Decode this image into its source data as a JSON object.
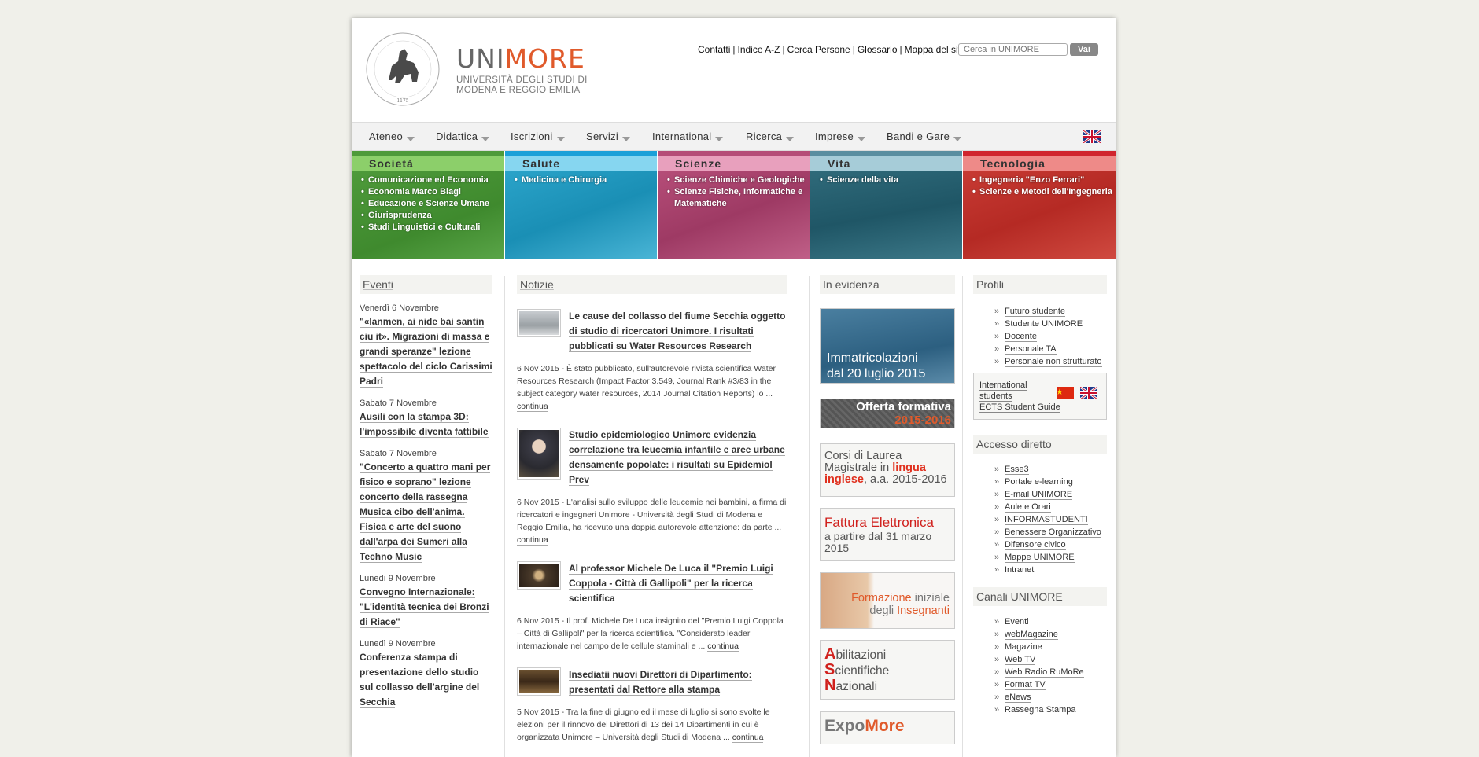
{
  "header": {
    "logo_word_1": "UNI",
    "logo_word_2": "MORE",
    "logo_sub_1": "UNIVERSITÀ DEGLI STUDI DI",
    "logo_sub_2": "MODENA E REGGIO EMILIA",
    "seal_text": "UNIVERSITAS STUDIORUM MUTINENSIS ET REGIENSIS",
    "seal_year": "1175",
    "links": [
      "Contatti",
      "Indice A-Z",
      "Cerca Persone",
      "Glossario",
      "Mappa del sito"
    ],
    "search_placeholder": "Cerca in UNIMORE",
    "search_button": "Vai"
  },
  "menu": [
    "Ateneo",
    "Didattica",
    "Iscrizioni",
    "Servizi",
    "International",
    "Ricerca",
    "Imprese",
    "Bandi e Gare"
  ],
  "areas": [
    {
      "title": "Società",
      "color": "#4e9a3a",
      "items": [
        "Comunicazione ed Economia",
        "Economia Marco Biagi",
        "Educazione e Scienze Umane",
        "Giurisprudenza",
        "Studi Linguistici e Culturali"
      ]
    },
    {
      "title": "Salute",
      "color": "#2aa3c9",
      "items": [
        "Medicina e Chirurgia"
      ]
    },
    {
      "title": "Scienze",
      "color": "#b54d78",
      "items": [
        "Scienze Chimiche e Geologiche",
        "Scienze Fisiche, Informatiche e Matematiche"
      ]
    },
    {
      "title": "Vita",
      "color": "#2f6a7a",
      "items": [
        "Scienze della vita"
      ]
    },
    {
      "title": "Tecnologia",
      "color": "#c73a33",
      "items": [
        "Ingegneria \"Enzo Ferrari\"",
        "Scienze e Metodi dell'Ingegneria"
      ]
    }
  ],
  "events": {
    "title": "Eventi",
    "items": [
      {
        "date": "Venerdì 6 Novembre",
        "title": "\"«Ianmen, ai nide bai santin ciu it». Migrazioni di massa e grandi speranze\" lezione spettacolo del ciclo Carissimi Padri"
      },
      {
        "date": "Sabato 7 Novembre",
        "title": "Ausili con la stampa 3D: l'impossibile diventa fattibile"
      },
      {
        "date": "Sabato 7 Novembre",
        "title": "\"Concerto a quattro mani per fisico e soprano\" lezione concerto della rassegna Musica cibo dell'anima. Fisica e arte del suono dall'arpa dei Sumeri alla Techno Music"
      },
      {
        "date": "Lunedì 9 Novembre",
        "title": "Convegno Internazionale: \"L'identità tecnica dei Bronzi di Riace\""
      },
      {
        "date": "Lunedì 9 Novembre",
        "title": "Conferenza stampa di presentazione dello studio sul collasso dell'argine del Secchia"
      }
    ]
  },
  "news": {
    "title": "Notizie",
    "more_label": "continua",
    "items": [
      {
        "title": "Le cause del collasso del fiume Secchia oggetto di studio di ricercatori Unimore. I risultati pubblicati su Water Resources Research",
        "text": "6 Nov 2015 - È stato pubblicato, sull'autorevole rivista scientifica Water Resources Research (Impact Factor 3.549, Journal Rank #3/83 in the subject category water resources, 2014 Journal Citation Reports) lo ..."
      },
      {
        "title": "Studio epidemiologico Unimore evidenzia correlazione tra leucemia infantile e aree urbane densamente popolate: i risultati su Epidemiol Prev",
        "text": "6 Nov 2015 - L'analisi sullo sviluppo delle leucemie nei bambini, a firma di ricercatori e ingegneri Unimore - Università degli Studi di Modena e Reggio Emilia, ha ricevuto una doppia autorevole attenzione: da parte ..."
      },
      {
        "title": "Al professor Michele De Luca il \"Premio Luigi Coppola - Città di Gallipoli\" per la ricerca scientifica",
        "text": "6 Nov 2015 - Il prof. Michele De Luca insignito del \"Premio Luigi Coppola – Città di Gallipoli\" per la ricerca scientifica. \"Considerato leader internazionale nel campo delle cellule staminali e ..."
      },
      {
        "title": "Insediatii nuovi Direttori di Dipartimento: presentati dal Rettore alla stampa",
        "text": "5 Nov 2015 - Tra la fine di giugno ed il mese di luglio si sono svolte le elezioni per il rinnovo dei Direttori di 13 dei 14 Dipartimenti in cui è organizzata Unimore – Università degli Studi di Modena ..."
      }
    ]
  },
  "evidenza": {
    "title": "In evidenza",
    "immatricolazioni_1": "Immatricolazioni",
    "immatricolazioni_2": "dal 20 luglio 2015",
    "offerta_1": "Offerta formativa",
    "offerta_2": "2015-2016",
    "corsi_1": "Corsi di Laurea",
    "corsi_2": "Magistrale in",
    "corsi_3": "lingua",
    "corsi_4": "inglese",
    "corsi_5": ", a.a. 2015-2016",
    "fattura_1": "Fattura Elettronica",
    "fattura_2": "a partire dal 31 marzo 2015",
    "formazione_1": "Formazione",
    "formazione_2": "iniziale",
    "formazione_3": "degli",
    "formazione_4": "Insegnanti",
    "asn_1": "bilitazioni",
    "asn_2": "cientifiche",
    "asn_3": "azionali",
    "asn_letters": [
      "A",
      "S",
      "N"
    ],
    "expo_1": "Expo",
    "expo_2": "More"
  },
  "profili": {
    "title": "Profili",
    "items": [
      "Futuro studente",
      "Studente UNIMORE",
      "Docente",
      "Personale TA",
      "Personale non strutturato"
    ],
    "intl_1": "International",
    "intl_2": "students",
    "intl_3": "ECTS Student Guide"
  },
  "accesso": {
    "title": "Accesso diretto",
    "items": [
      "Esse3",
      "Portale e-learning",
      "E-mail UNIMORE",
      "Aule e Orari",
      "INFORMASTUDENTI",
      "Benessere Organizzativo",
      "Difensore civico",
      "Mappe UNIMORE",
      "Intranet"
    ]
  },
  "canali": {
    "title": "Canali UNIMORE",
    "items": [
      "Eventi",
      "webMagazine",
      "Magazine",
      "Web TV",
      "Web Radio RuMoRe",
      "Format TV",
      "eNews",
      "Rassegna Stampa"
    ]
  }
}
